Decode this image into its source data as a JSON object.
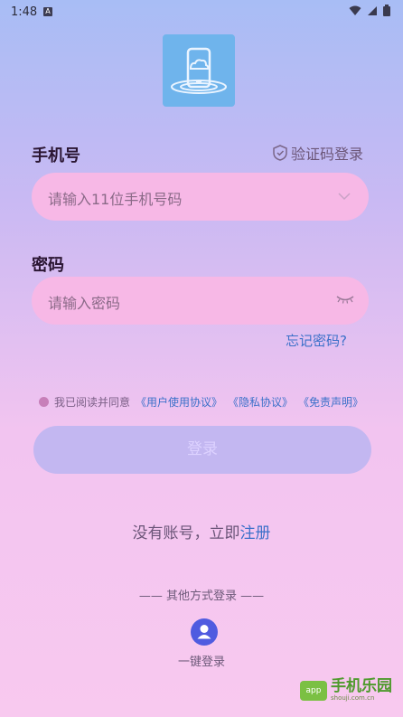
{
  "status_bar": {
    "time": "1:48",
    "notif_badge": "A"
  },
  "form": {
    "phone_label": "手机号",
    "sms_login_label": "验证码登录",
    "phone_placeholder": "请输入11位手机号码",
    "password_label": "密码",
    "password_placeholder": "请输入密码",
    "forgot_password": "忘记密码?"
  },
  "agreement": {
    "prefix": "我已阅读并同意",
    "user_agreement": "《用户使用协议》",
    "privacy_policy": "《隐私协议》",
    "disclaimer": "《免责声明》"
  },
  "login_button": "登录",
  "register": {
    "prefix": "没有账号，立即",
    "link": "注册"
  },
  "other_login": {
    "title": "—— 其他方式登录 ——",
    "one_key_label": "一键登录"
  },
  "watermark": {
    "badge": "app",
    "title": "手机乐园",
    "url": "shouji.com.cn"
  },
  "colors": {
    "link": "#3b70c9",
    "field_bg": "#f7b8e6",
    "button_bg": "#c3b7f1",
    "logo_bg": "#6fb4ec"
  }
}
